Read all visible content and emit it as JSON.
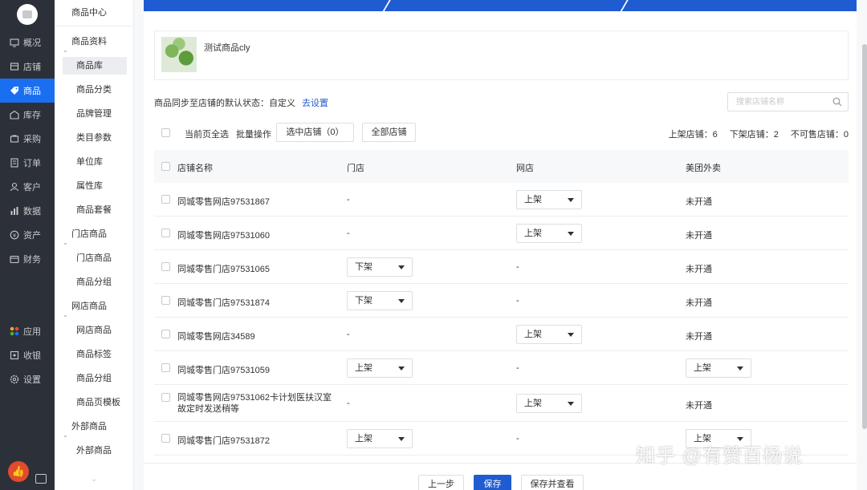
{
  "leftnav": {
    "items": [
      {
        "label": "概况",
        "icon": "monitor-icon"
      },
      {
        "label": "店铺",
        "icon": "store-icon"
      },
      {
        "label": "商品",
        "icon": "tag-icon",
        "active": true
      },
      {
        "label": "库存",
        "icon": "warehouse-icon"
      },
      {
        "label": "采购",
        "icon": "cart-icon"
      },
      {
        "label": "订单",
        "icon": "document-icon"
      },
      {
        "label": "客户",
        "icon": "user-icon"
      },
      {
        "label": "数据",
        "icon": "chart-icon"
      },
      {
        "label": "资产",
        "icon": "coin-icon"
      },
      {
        "label": "财务",
        "icon": "wallet-icon"
      }
    ],
    "bottom_items": [
      {
        "label": "应用",
        "icon": "apps-icon"
      },
      {
        "label": "收银",
        "icon": "cashier-icon"
      },
      {
        "label": "设置",
        "icon": "gear-icon"
      }
    ]
  },
  "subnav": {
    "title": "商品中心",
    "groups": [
      {
        "label": "商品资料",
        "items": [
          "商品库",
          "商品分类",
          "品牌管理",
          "类目参数",
          "单位库",
          "属性库",
          "商品套餐"
        ]
      },
      {
        "label": "门店商品",
        "items": [
          "门店商品",
          "商品分组"
        ]
      },
      {
        "label": "网店商品",
        "items": [
          "网店商品",
          "商品标签",
          "商品分组",
          "商品页模板"
        ]
      },
      {
        "label": "外部商品",
        "items": [
          "外部商品"
        ]
      }
    ]
  },
  "product": {
    "name": "测试商品cly"
  },
  "sync": {
    "label": "商品同步至店铺的默认状态：",
    "value": "自定义",
    "link": "去设置"
  },
  "search": {
    "placeholder": "搜索店铺名称"
  },
  "toolbar": {
    "select_page": "当前页全选",
    "batch": "批量操作",
    "selected_btn": "选中店铺（0）",
    "all_btn": "全部店铺",
    "stats": [
      "上架店铺：6",
      "下架店铺：2",
      "不可售店铺：0"
    ]
  },
  "table": {
    "headers": [
      "店铺名称",
      "门店",
      "网店",
      "美团外卖"
    ],
    "rows": [
      {
        "name": "同城零售网店97531867",
        "store": "-",
        "online": "上架",
        "meituan": "未开通",
        "store_dd": false,
        "online_dd": true,
        "meituan_dd": false
      },
      {
        "name": "同城零售网店97531060",
        "store": "-",
        "online": "上架",
        "meituan": "未开通",
        "store_dd": false,
        "online_dd": true,
        "meituan_dd": false
      },
      {
        "name": "同城零售门店97531065",
        "store": "下架",
        "online": "-",
        "meituan": "未开通",
        "store_dd": true,
        "online_dd": false,
        "meituan_dd": false
      },
      {
        "name": "同城零售门店97531874",
        "store": "下架",
        "online": "-",
        "meituan": "未开通",
        "store_dd": true,
        "online_dd": false,
        "meituan_dd": false
      },
      {
        "name": "同城零售网店34589",
        "store": "-",
        "online": "上架",
        "meituan": "未开通",
        "store_dd": false,
        "online_dd": true,
        "meituan_dd": false
      },
      {
        "name": "同城零售门店97531059",
        "store": "上架",
        "online": "-",
        "meituan": "上架",
        "store_dd": true,
        "online_dd": false,
        "meituan_dd": true
      },
      {
        "name": "同城零售网店97531062卡计划医扶汉室故定时发送稍等",
        "store": "-",
        "online": "上架",
        "meituan": "未开通",
        "store_dd": false,
        "online_dd": true,
        "meituan_dd": false,
        "tall": true
      },
      {
        "name": "同城零售门店97531872",
        "store": "上架",
        "online": "-",
        "meituan": "上架",
        "store_dd": true,
        "online_dd": false,
        "meituan_dd": true
      }
    ]
  },
  "footer": {
    "prev": "上一步",
    "save": "保存",
    "save_view": "保存并查看"
  },
  "watermark": "知乎 @有赞百杨说",
  "colors": {
    "primary": "#1f5cd1",
    "nav_bg": "#2c3139",
    "active_nav": "#1a6ff0"
  }
}
